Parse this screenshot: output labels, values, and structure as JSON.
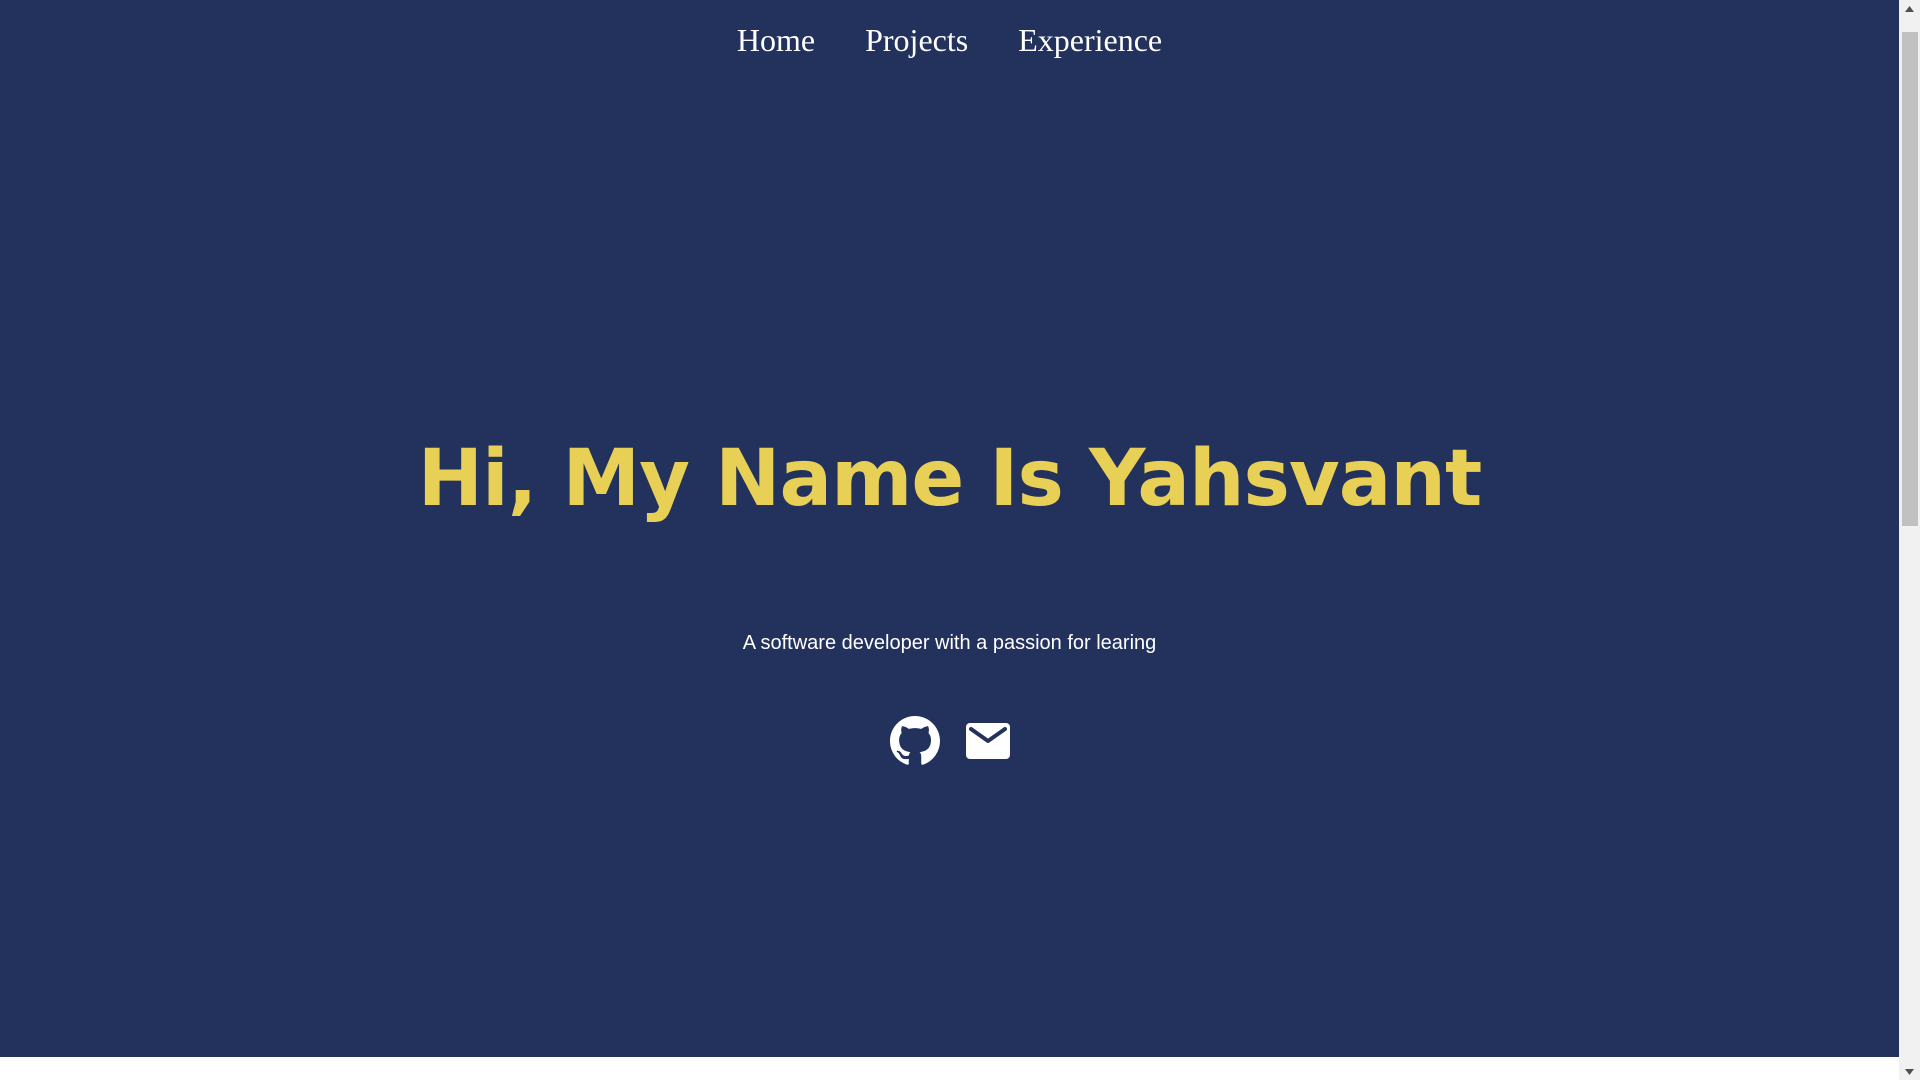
{
  "nav": {
    "items": [
      {
        "label": "Home"
      },
      {
        "label": "Projects"
      },
      {
        "label": "Experience"
      }
    ]
  },
  "hero": {
    "title": "Hi, My Name Is Yahsvant",
    "subtitle": "A software developer with a passion for learing"
  },
  "social": {
    "github_icon": "github-icon",
    "email_icon": "mail-icon"
  },
  "colors": {
    "background": "#22325d",
    "accent": "#e8cf55",
    "text": "#ffffff"
  }
}
